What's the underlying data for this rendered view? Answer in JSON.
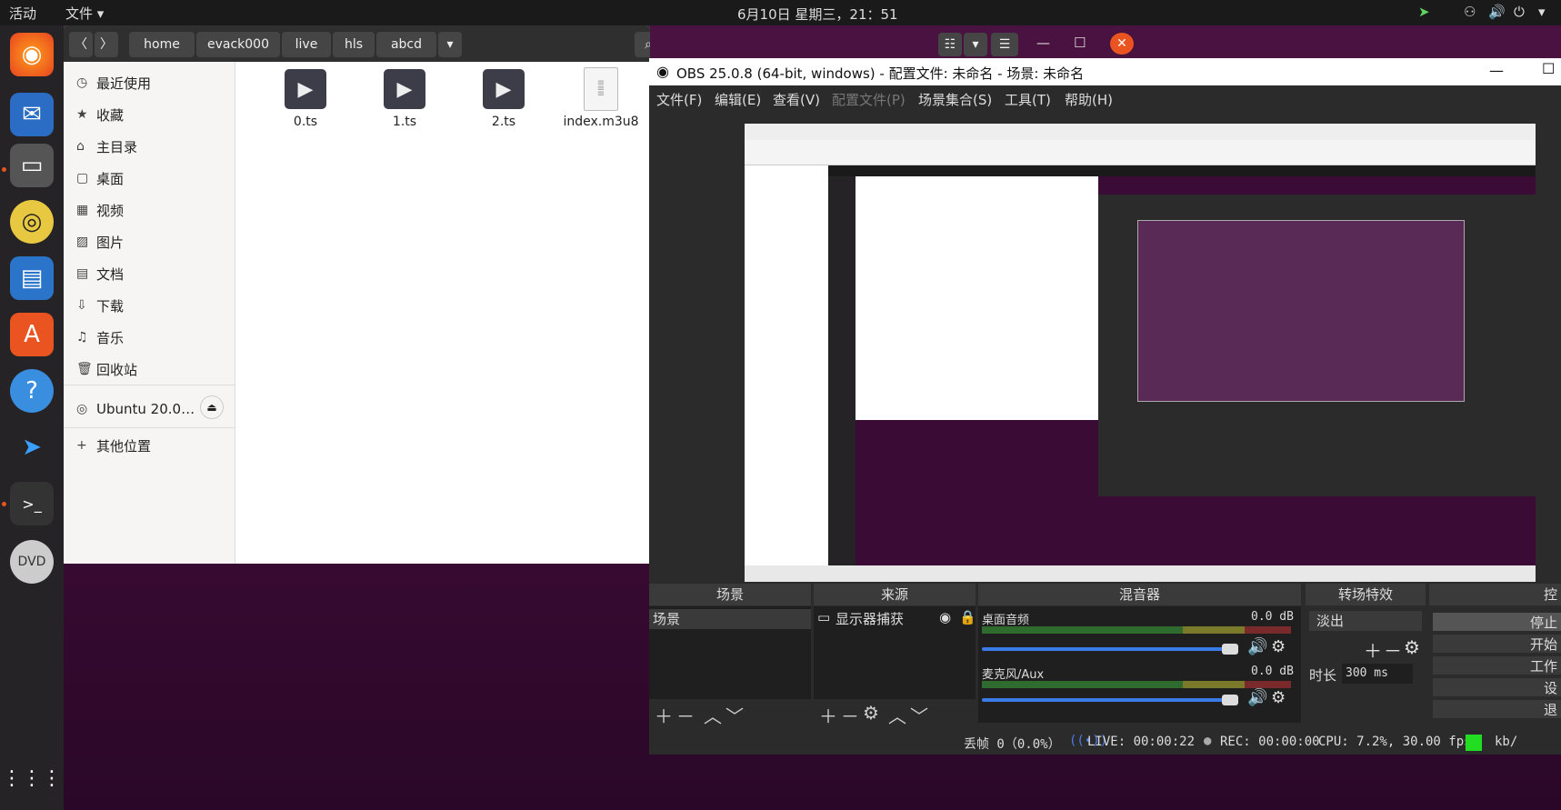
{
  "topbar": {
    "activities": "活动",
    "files_menu": "文件 ▾",
    "clock": "6月10日 星期三，21：51"
  },
  "nautilus": {
    "path": [
      "home",
      "evack000",
      "live",
      "hls",
      "abcd"
    ],
    "sidebar": [
      "最近使用",
      "收藏",
      "主目录",
      "桌面",
      "视频",
      "图片",
      "文档",
      "下载",
      "音乐",
      "回收站"
    ],
    "device": "Ubuntu 20.0…",
    "other": "其他位置",
    "files": [
      "0.ts",
      "1.ts",
      "2.ts",
      "index.m3u8"
    ]
  },
  "obs": {
    "title": "OBS 25.0.8 (64-bit, windows) - 配置文件: 未命名 - 场景: 未命名",
    "menu": [
      "文件(F)",
      "编辑(E)",
      "查看(V)",
      "配置文件(P)",
      "场景集合(S)",
      "工具(T)",
      "帮助(H)"
    ],
    "panels": {
      "scenes": "场景",
      "sources": "来源",
      "mixer": "混音器",
      "transitions": "转场特效",
      "controls": "控"
    },
    "scene_item": "场景",
    "source_item": "显示器捕获",
    "mixer": [
      {
        "name": "桌面音频",
        "db": "0.0 dB"
      },
      {
        "name": "麦克风/Aux",
        "db": "0.0 dB"
      }
    ],
    "transition": "淡出",
    "duration_label": "时长",
    "duration_value": "300 ms",
    "controls": [
      "停止",
      "开始",
      "工作",
      "设",
      "退"
    ],
    "status": {
      "dropped": "丢帧 0（0.0%）",
      "live": "LIVE: 00:00:22",
      "rec": "REC: 00:00:00",
      "cpu": "CPU: 7.2%, 30.00 fps",
      "kb": "kb/"
    }
  }
}
